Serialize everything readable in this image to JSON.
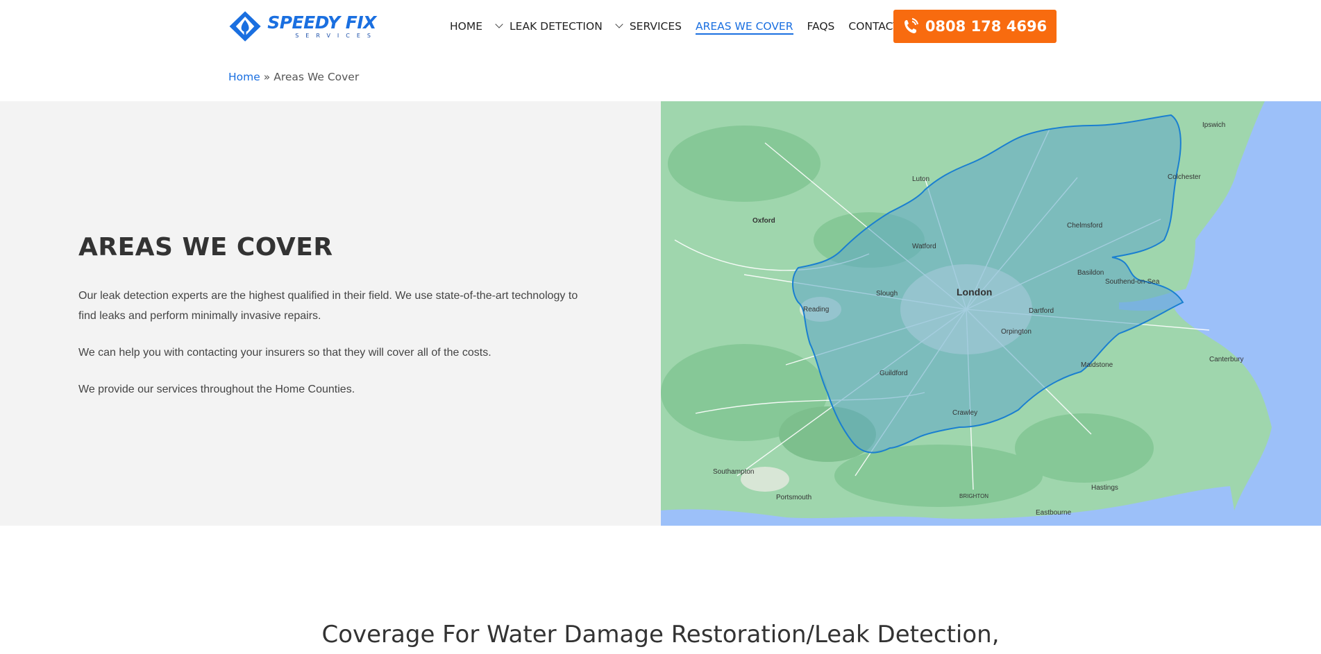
{
  "brand": {
    "name": "SPEEDY FIX",
    "tagline": "SERVICES",
    "accent": "#1a6fe0",
    "cta_color": "#f86b0f"
  },
  "nav": {
    "items": [
      {
        "label": "HOME",
        "dropdown": false,
        "active": false
      },
      {
        "label": "LEAK DETECTION",
        "dropdown": true,
        "active": false
      },
      {
        "label": "SERVICES",
        "dropdown": true,
        "active": false
      },
      {
        "label": "AREAS WE COVER",
        "dropdown": false,
        "active": true
      },
      {
        "label": "FAQS",
        "dropdown": false,
        "active": false
      },
      {
        "label": "CONTACT",
        "dropdown": false,
        "active": false
      }
    ],
    "phone": "0808 178 4696",
    "phone_icon": "phone-icon"
  },
  "breadcrumb": {
    "home": "Home",
    "separator": "»",
    "current": "Areas We Cover"
  },
  "hero": {
    "title": "AREAS WE COVER",
    "paragraphs": [
      "Our leak detection experts are the highest qualified in their field. We use state-of-the-art technology to find leaks and perform minimally invasive repairs.",
      "We can help you with contacting your insurers so that they will cover all of the costs.",
      "We provide our services throughout the Home Counties."
    ]
  },
  "map": {
    "labels": {
      "london": "London",
      "reading": "Reading",
      "oxford": "Oxford",
      "watford": "Watford",
      "chelmsford": "Chelmsford",
      "colchester": "Colchester",
      "southend": "Southend-on-Sea",
      "guildford": "Guildford",
      "crawley": "Crawley",
      "maidstone": "Maidstone",
      "brighton": "BRIGHTON",
      "eastbourne": "Eastbourne",
      "portsmouth": "Portsmouth",
      "southampton": "Southampton",
      "luton": "Luton",
      "ipswich": "Ipswich",
      "canterbury": "Canterbury",
      "hastings": "Hastings",
      "slough": "Slough",
      "sevenoaks": "Orpington",
      "basildon": "Basildon",
      "dartford": "Dartford"
    },
    "coverage_color": "#5fa8c9"
  },
  "coverage": {
    "title": "Coverage For Water Damage Restoration/Leak Detection,"
  }
}
